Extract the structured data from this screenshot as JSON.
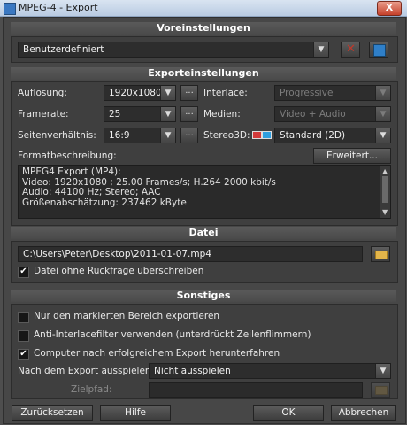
{
  "window": {
    "title": "MPEG-4 - Export",
    "close_label": "X"
  },
  "presets": {
    "header": "Voreinstellungen",
    "selected": "Benutzerdefiniert"
  },
  "export_settings": {
    "header": "Exporteinstellungen",
    "resolution_label": "Auflösung:",
    "resolution_value": "1920x1080",
    "framerate_label": "Framerate:",
    "framerate_value": "25",
    "aspect_label": "Seitenverhältnis:",
    "aspect_value": "16:9",
    "interlace_label": "Interlace:",
    "interlace_value": "Progressive",
    "media_label": "Medien:",
    "media_value": "Video + Audio",
    "stereo_label": "Stereo3D:",
    "stereo_value": "Standard (2D)",
    "format_desc_label": "Formatbeschreibung:",
    "advanced_button": "Erweitert...",
    "dots_label": "...",
    "format_lines": [
      "MPEG4 Export (MP4):",
      "Video: 1920x1080 ; 25.00 Frames/s; H.264 2000 kbit/s",
      "Audio: 44100 Hz; Stereo;  AAC",
      "Größenabschätzung: 237462 kByte"
    ]
  },
  "file": {
    "header": "Datei",
    "path": "C:\\Users\\Peter\\Desktop\\2011-01-07.mp4",
    "overwrite_label": "Datei ohne Rückfrage überschreiben",
    "overwrite_checked": true
  },
  "other": {
    "header": "Sonstiges",
    "marked_only_label": "Nur den markierten Bereich exportieren",
    "marked_only_checked": false,
    "deinterlace_label": "Anti-Interlacefilter verwenden (unterdrückt Zeilenflimmern)",
    "deinterlace_checked": false,
    "shutdown_label": "Computer nach erfolgreichem Export herunterfahren",
    "shutdown_checked": true,
    "play_after_label": "Nach dem Export ausspielen:",
    "play_after_value": "Nicht ausspielen",
    "target_label": "Zielpfad:"
  },
  "footer": {
    "reset": "Zurücksetzen",
    "help": "Hilfe",
    "ok": "OK",
    "cancel": "Abbrechen"
  },
  "colors": {
    "delete_icon": "#c0392b",
    "save_icon": "#2f7fc8",
    "folder_icon": "#e3b54a",
    "stereo_glasses": "#d33a3a"
  }
}
